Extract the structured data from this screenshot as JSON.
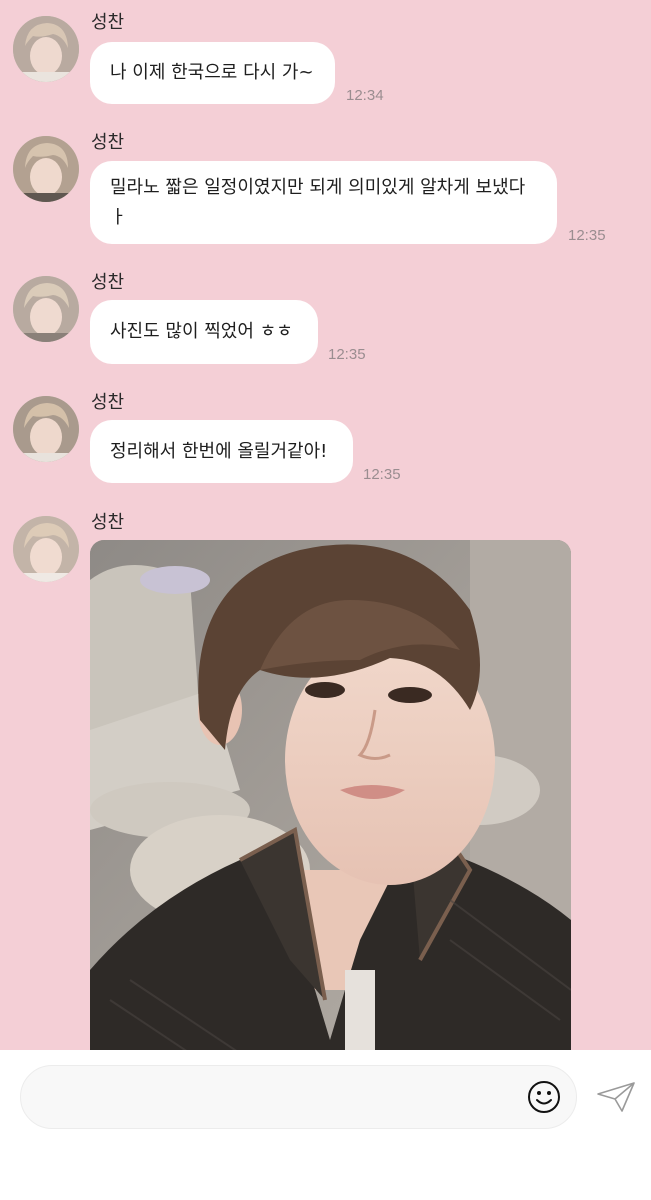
{
  "chat": {
    "messages": [
      {
        "sender": "성찬",
        "text": "나 이제 한국으로 다시 가~",
        "time": "12:34"
      },
      {
        "sender": "성찬",
        "text": "밀라노 짧은 일정이였지만 되게 의미있게 알차게 보냈다\nㅏ",
        "time": "12:35"
      },
      {
        "sender": "성찬",
        "text": "사진도 많이 찍었어 ㅎㅎ",
        "time": "12:35"
      },
      {
        "sender": "성찬",
        "text": "정리해서 한번에 올릴거같아!",
        "time": "12:35"
      },
      {
        "sender": "성찬",
        "type": "image"
      }
    ]
  },
  "composer": {
    "value": "",
    "emoji_icon": "smiley-face-icon",
    "send_icon": "paper-plane-icon"
  },
  "colors": {
    "background": "#f4cfd6",
    "bubble": "#ffffff",
    "timestamp": "#9a8d90"
  }
}
